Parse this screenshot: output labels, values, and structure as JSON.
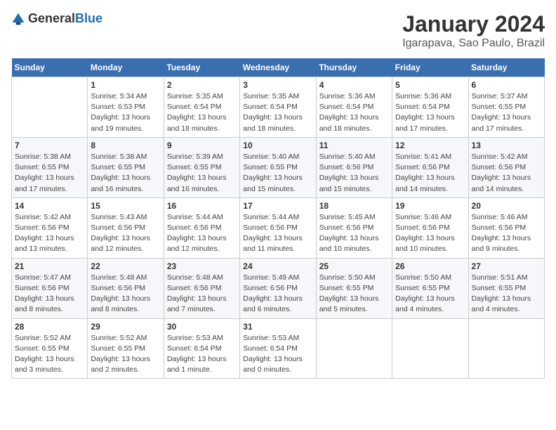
{
  "logo": {
    "text_general": "General",
    "text_blue": "Blue"
  },
  "title": "January 2024",
  "subtitle": "Igarapava, Sao Paulo, Brazil",
  "days_of_week": [
    "Sunday",
    "Monday",
    "Tuesday",
    "Wednesday",
    "Thursday",
    "Friday",
    "Saturday"
  ],
  "weeks": [
    [
      {
        "day": "",
        "info": ""
      },
      {
        "day": "1",
        "info": "Sunrise: 5:34 AM\nSunset: 6:53 PM\nDaylight: 13 hours\nand 19 minutes."
      },
      {
        "day": "2",
        "info": "Sunrise: 5:35 AM\nSunset: 6:54 PM\nDaylight: 13 hours\nand 18 minutes."
      },
      {
        "day": "3",
        "info": "Sunrise: 5:35 AM\nSunset: 6:54 PM\nDaylight: 13 hours\nand 18 minutes."
      },
      {
        "day": "4",
        "info": "Sunrise: 5:36 AM\nSunset: 6:54 PM\nDaylight: 13 hours\nand 18 minutes."
      },
      {
        "day": "5",
        "info": "Sunrise: 5:36 AM\nSunset: 6:54 PM\nDaylight: 13 hours\nand 17 minutes."
      },
      {
        "day": "6",
        "info": "Sunrise: 5:37 AM\nSunset: 6:55 PM\nDaylight: 13 hours\nand 17 minutes."
      }
    ],
    [
      {
        "day": "7",
        "info": "Sunrise: 5:38 AM\nSunset: 6:55 PM\nDaylight: 13 hours\nand 17 minutes."
      },
      {
        "day": "8",
        "info": "Sunrise: 5:38 AM\nSunset: 6:55 PM\nDaylight: 13 hours\nand 16 minutes."
      },
      {
        "day": "9",
        "info": "Sunrise: 5:39 AM\nSunset: 6:55 PM\nDaylight: 13 hours\nand 16 minutes."
      },
      {
        "day": "10",
        "info": "Sunrise: 5:40 AM\nSunset: 6:55 PM\nDaylight: 13 hours\nand 15 minutes."
      },
      {
        "day": "11",
        "info": "Sunrise: 5:40 AM\nSunset: 6:56 PM\nDaylight: 13 hours\nand 15 minutes."
      },
      {
        "day": "12",
        "info": "Sunrise: 5:41 AM\nSunset: 6:56 PM\nDaylight: 13 hours\nand 14 minutes."
      },
      {
        "day": "13",
        "info": "Sunrise: 5:42 AM\nSunset: 6:56 PM\nDaylight: 13 hours\nand 14 minutes."
      }
    ],
    [
      {
        "day": "14",
        "info": "Sunrise: 5:42 AM\nSunset: 6:56 PM\nDaylight: 13 hours\nand 13 minutes."
      },
      {
        "day": "15",
        "info": "Sunrise: 5:43 AM\nSunset: 6:56 PM\nDaylight: 13 hours\nand 12 minutes."
      },
      {
        "day": "16",
        "info": "Sunrise: 5:44 AM\nSunset: 6:56 PM\nDaylight: 13 hours\nand 12 minutes."
      },
      {
        "day": "17",
        "info": "Sunrise: 5:44 AM\nSunset: 6:56 PM\nDaylight: 13 hours\nand 11 minutes."
      },
      {
        "day": "18",
        "info": "Sunrise: 5:45 AM\nSunset: 6:56 PM\nDaylight: 13 hours\nand 10 minutes."
      },
      {
        "day": "19",
        "info": "Sunrise: 5:46 AM\nSunset: 6:56 PM\nDaylight: 13 hours\nand 10 minutes."
      },
      {
        "day": "20",
        "info": "Sunrise: 5:46 AM\nSunset: 6:56 PM\nDaylight: 13 hours\nand 9 minutes."
      }
    ],
    [
      {
        "day": "21",
        "info": "Sunrise: 5:47 AM\nSunset: 6:56 PM\nDaylight: 13 hours\nand 8 minutes."
      },
      {
        "day": "22",
        "info": "Sunrise: 5:48 AM\nSunset: 6:56 PM\nDaylight: 13 hours\nand 8 minutes."
      },
      {
        "day": "23",
        "info": "Sunrise: 5:48 AM\nSunset: 6:56 PM\nDaylight: 13 hours\nand 7 minutes."
      },
      {
        "day": "24",
        "info": "Sunrise: 5:49 AM\nSunset: 6:56 PM\nDaylight: 13 hours\nand 6 minutes."
      },
      {
        "day": "25",
        "info": "Sunrise: 5:50 AM\nSunset: 6:55 PM\nDaylight: 13 hours\nand 5 minutes."
      },
      {
        "day": "26",
        "info": "Sunrise: 5:50 AM\nSunset: 6:55 PM\nDaylight: 13 hours\nand 4 minutes."
      },
      {
        "day": "27",
        "info": "Sunrise: 5:51 AM\nSunset: 6:55 PM\nDaylight: 13 hours\nand 4 minutes."
      }
    ],
    [
      {
        "day": "28",
        "info": "Sunrise: 5:52 AM\nSunset: 6:55 PM\nDaylight: 13 hours\nand 3 minutes."
      },
      {
        "day": "29",
        "info": "Sunrise: 5:52 AM\nSunset: 6:55 PM\nDaylight: 13 hours\nand 2 minutes."
      },
      {
        "day": "30",
        "info": "Sunrise: 5:53 AM\nSunset: 6:54 PM\nDaylight: 13 hours\nand 1 minute."
      },
      {
        "day": "31",
        "info": "Sunrise: 5:53 AM\nSunset: 6:54 PM\nDaylight: 13 hours\nand 0 minutes."
      },
      {
        "day": "",
        "info": ""
      },
      {
        "day": "",
        "info": ""
      },
      {
        "day": "",
        "info": ""
      }
    ]
  ]
}
